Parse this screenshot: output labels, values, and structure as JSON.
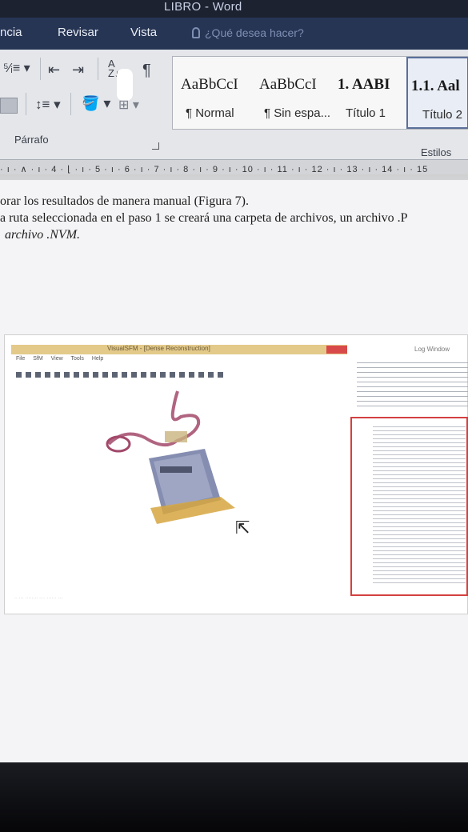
{
  "window": {
    "title": "LIBRO - Word"
  },
  "ribbon_tabs": [
    {
      "label": "ncia"
    },
    {
      "label": "Revisar"
    },
    {
      "label": "Vista"
    }
  ],
  "tell_me": {
    "placeholder": "¿Qué desea hacer?"
  },
  "paragraph_group": {
    "label": "Párrafo",
    "icons": [
      "multilevel-list-icon",
      "decrease-indent-icon",
      "increase-indent-icon",
      "sort-icon",
      "show-marks-icon",
      "align-justify-icon",
      "line-spacing-icon",
      "shading-icon",
      "borders-icon"
    ]
  },
  "styles_group": {
    "label": "Estilos",
    "items": [
      {
        "sample": "AaBbCcI",
        "name": "¶ Normal"
      },
      {
        "sample": "AaBbCcI",
        "name": "¶ Sin espa..."
      },
      {
        "sample": "1.  AABI",
        "name": "Título 1"
      },
      {
        "sample": "1.1.  Aal",
        "name": "Título 2"
      }
    ]
  },
  "ruler": {
    "ticks": "· ı · ∧ · ı · 4 · ⌊ · ı · 5 · ı · 6 · ı · 7 · ı · 8 · ı · 9 · ı · 10 · ı · 11 · ı · 12 · ı · 13 · ı · 14 · ı · 15"
  },
  "document": {
    "lines": [
      "orar los resultados de manera manual (Figura 7).",
      "a ruta seleccionada en el paso 1 se creará una carpeta de archivos, un archivo .P",
      "archivo .NVM."
    ]
  },
  "figure": {
    "app_title": "VisualSFM - [Dense Reconstruction]",
    "menu": [
      "File",
      "SfM",
      "View",
      "Tools",
      "Help"
    ],
    "log_window_title": "Log Window",
    "colors": {
      "title_bar": "#e3c98a",
      "highlight_box": "#d2403f",
      "model_blue": "#7882a8",
      "camera_path": "#a2496a"
    }
  }
}
